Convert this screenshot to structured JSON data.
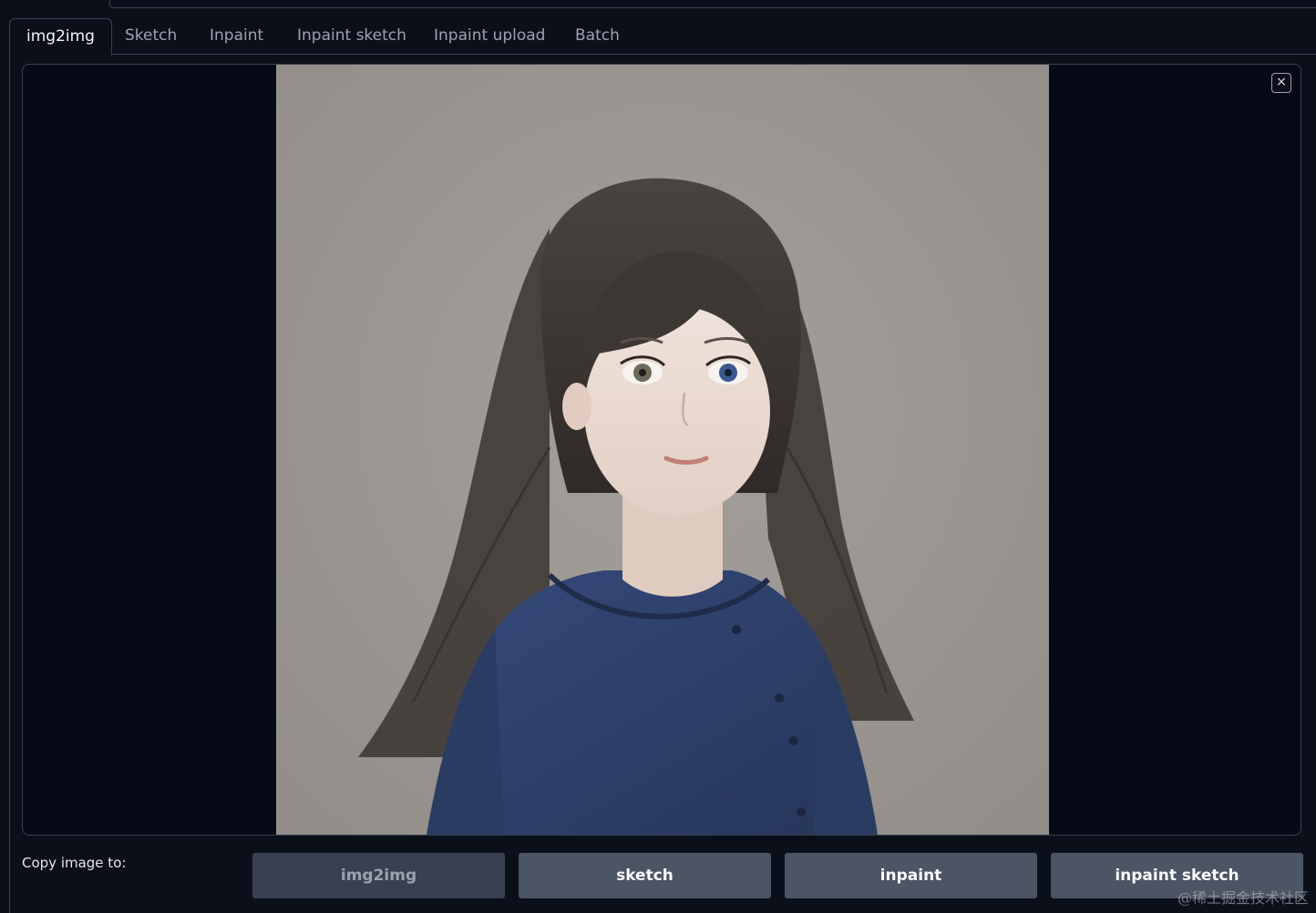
{
  "tabs": [
    {
      "label": "img2img",
      "active": true
    },
    {
      "label": "Sketch",
      "active": false
    },
    {
      "label": "Inpaint",
      "active": false
    },
    {
      "label": "Inpaint sketch",
      "active": false
    },
    {
      "label": "Inpaint upload",
      "active": false
    },
    {
      "label": "Batch",
      "active": false
    }
  ],
  "image_panel": {
    "close_icon": "×"
  },
  "copy": {
    "label": "Copy image to:",
    "buttons": [
      {
        "label": "img2img",
        "enabled": false
      },
      {
        "label": "sketch",
        "enabled": true
      },
      {
        "label": "inpaint",
        "enabled": true
      },
      {
        "label": "inpaint sketch",
        "enabled": true
      }
    ]
  },
  "watermark": "@稀土掘金技术社区",
  "colors": {
    "background": "#0b0f19",
    "border": "#374151",
    "button": "#4b5563",
    "photo_bg": "#9c9894",
    "shirt": "#2f4269"
  }
}
